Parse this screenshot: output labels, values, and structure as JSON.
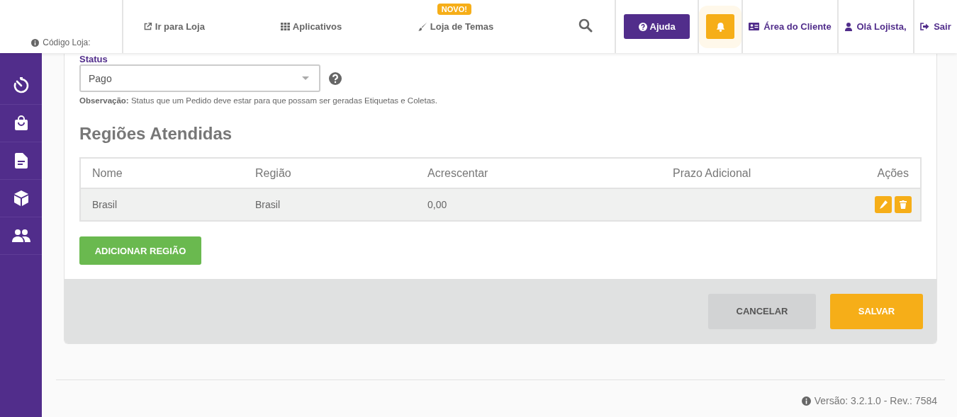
{
  "header": {
    "store_code_label": "Código Loja:",
    "nav": [
      {
        "label": "Ir para Loja"
      },
      {
        "label": "Aplicativos"
      },
      {
        "label": "Loja de Temas",
        "badge": "NOVO!"
      }
    ],
    "help_button": "Ajuda",
    "user_links": [
      {
        "label": "Área do Cliente"
      },
      {
        "label": "Olá Lojista,"
      },
      {
        "label": "Sair"
      }
    ]
  },
  "form": {
    "status_label": "Status",
    "status_value": "Pago",
    "note": "**Observação:** Status que um Pedido deve estar para que possam ser geradas Etiquetas e Coletas."
  },
  "regions": {
    "title": "Regiões Atendidas",
    "columns": [
      "Nome",
      "Região",
      "Acrescentar",
      "Prazo Adicional",
      "Ações"
    ],
    "rows": [
      {
        "cells": [
          "Brasil",
          "Brasil",
          "0,00"
        ]
      }
    ],
    "add_button": "ADICIONAR REGIÃO"
  },
  "actions": {
    "cancel": "CANCELAR",
    "save": "SALVAR"
  },
  "footer": {
    "version": "Versão: 3.2.1.0 - Rev.: 7584"
  }
}
